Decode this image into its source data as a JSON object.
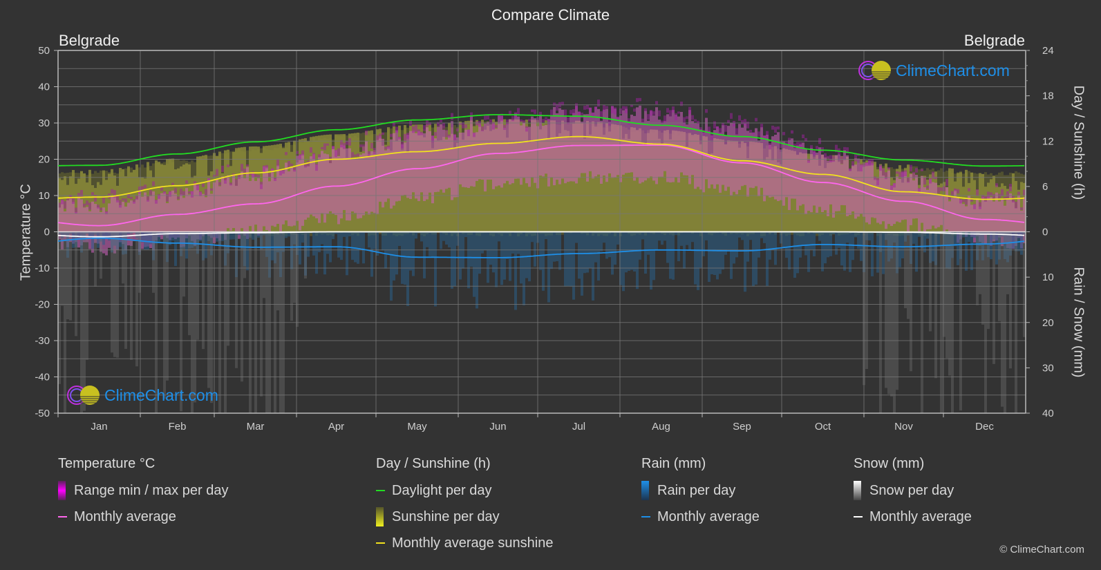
{
  "title": "Compare Climate",
  "city_left": "Belgrade",
  "city_right": "Belgrade",
  "watermark": "ClimeChart.com",
  "copyright": "© ClimeChart.com",
  "chart_data": {
    "type": "line",
    "title": "Compare Climate",
    "categories": [
      "Jan",
      "Feb",
      "Mar",
      "Apr",
      "May",
      "Jun",
      "Jul",
      "Aug",
      "Sep",
      "Oct",
      "Nov",
      "Dec"
    ],
    "axes": {
      "left": {
        "label": "Temperature °C",
        "range": [
          -50,
          50
        ],
        "ticks": [
          50,
          40,
          30,
          20,
          10,
          0,
          -10,
          -20,
          -30,
          -40,
          -50
        ]
      },
      "right_top": {
        "label": "Day / Sunshine (h)",
        "range": [
          0,
          24
        ],
        "ticks": [
          24,
          18,
          12,
          6,
          0
        ]
      },
      "right_bottom": {
        "label": "Rain / Snow (mm)",
        "range": [
          0,
          40
        ],
        "ticks": [
          0,
          10,
          20,
          30,
          40
        ]
      }
    },
    "grid": true,
    "series": [
      {
        "name": "Temperature monthly average",
        "axis": "left",
        "unit": "°C",
        "color": "#ff66ee",
        "values": [
          1.7,
          4.8,
          7.7,
          12.6,
          17.4,
          21.6,
          23.8,
          23.9,
          19.0,
          13.6,
          8.4,
          3.4
        ]
      },
      {
        "name": "Daylight per day",
        "axis": "right_top",
        "unit": "h",
        "color": "#22dd22",
        "values": [
          8.8,
          10.3,
          11.9,
          13.5,
          14.8,
          15.5,
          15.3,
          14.1,
          12.6,
          10.8,
          9.5,
          8.7
        ]
      },
      {
        "name": "Monthly average sunshine",
        "axis": "right_top",
        "unit": "h",
        "color": "#f2e21e",
        "values": [
          4.6,
          6.1,
          7.8,
          9.6,
          10.6,
          11.7,
          12.6,
          11.6,
          9.4,
          7.6,
          5.3,
          4.3
        ]
      },
      {
        "name": "Rain monthly average",
        "axis": "right_bottom",
        "unit": "mm",
        "color": "#1e8fe8",
        "values": [
          1.4,
          2.5,
          3.4,
          3.3,
          5.6,
          5.7,
          4.8,
          4.0,
          4.2,
          2.8,
          3.3,
          2.7
        ]
      },
      {
        "name": "Snow monthly average",
        "axis": "right_bottom",
        "unit": "mm",
        "color": "#ffffff",
        "values": [
          1.1,
          0.4,
          0.2,
          0,
          0,
          0,
          0,
          0,
          0,
          0,
          0.1,
          0.5
        ]
      }
    ],
    "ranges": {
      "temperature_min_approx": [
        -3,
        -1,
        2,
        6,
        11,
        15,
        17,
        17,
        13,
        8,
        4,
        0
      ],
      "temperature_max_approx": [
        5,
        8,
        13,
        19,
        24,
        28,
        30,
        30,
        25,
        19,
        12,
        6
      ]
    }
  },
  "legend": {
    "groups": [
      {
        "header": "Temperature °C",
        "items": [
          {
            "label": "Range min / max per day",
            "kind": "bar",
            "color": "#e020e0"
          },
          {
            "label": "Monthly average",
            "kind": "line",
            "color": "#ff66ee"
          }
        ]
      },
      {
        "header": "Day / Sunshine (h)",
        "items": [
          {
            "label": "Daylight per day",
            "kind": "line",
            "color": "#22dd22"
          },
          {
            "label": "Sunshine per day",
            "kind": "bar",
            "color": "#e8e830"
          },
          {
            "label": "Monthly average sunshine",
            "kind": "line",
            "color": "#f2e21e"
          }
        ]
      },
      {
        "header": "Rain (mm)",
        "items": [
          {
            "label": "Rain per day",
            "kind": "bar",
            "color": "#1e8fe8"
          },
          {
            "label": "Monthly average",
            "kind": "line",
            "color": "#1e8fe8"
          }
        ]
      },
      {
        "header": "Snow (mm)",
        "items": [
          {
            "label": "Snow per day",
            "kind": "bar",
            "color": "#ffffff"
          },
          {
            "label": "Monthly average",
            "kind": "line",
            "color": "#ffffff"
          }
        ]
      }
    ]
  }
}
